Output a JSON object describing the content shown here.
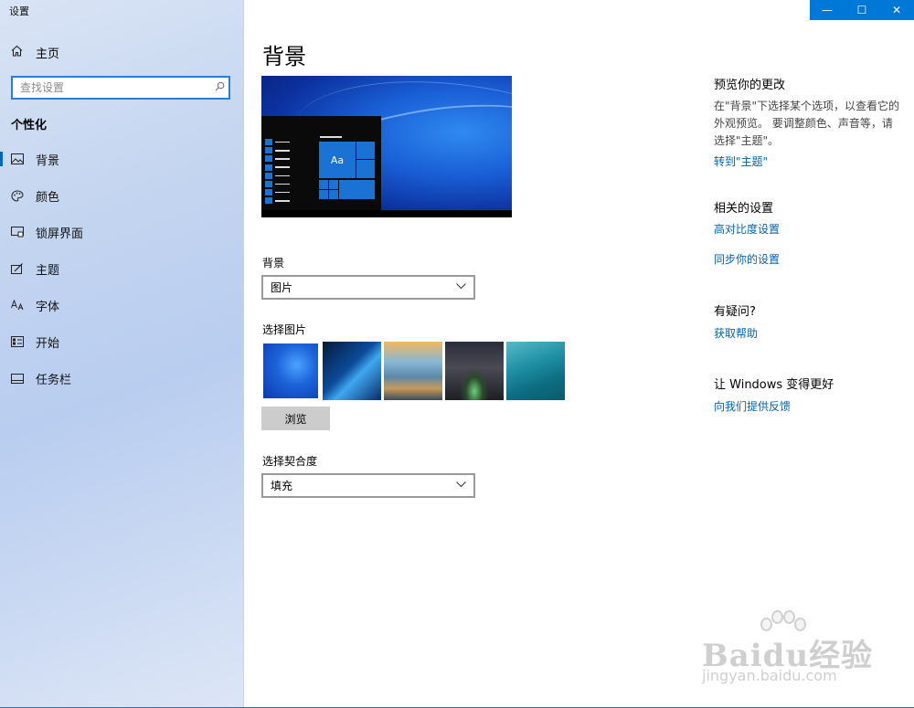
{
  "window": {
    "title": "设置",
    "controls": {
      "minimize": "—",
      "maximize": "☐",
      "close": "✕"
    }
  },
  "sidebar": {
    "home_label": "主页",
    "search_placeholder": "查找设置",
    "section_title": "个性化",
    "items": [
      {
        "label": "背景",
        "icon": "picture-icon",
        "active": true
      },
      {
        "label": "颜色",
        "icon": "palette-icon",
        "active": false
      },
      {
        "label": "锁屏界面",
        "icon": "lock-screen-icon",
        "active": false
      },
      {
        "label": "主题",
        "icon": "theme-icon",
        "active": false
      },
      {
        "label": "字体",
        "icon": "font-icon",
        "active": false
      },
      {
        "label": "开始",
        "icon": "start-icon",
        "active": false
      },
      {
        "label": "任务栏",
        "icon": "taskbar-icon",
        "active": false
      }
    ]
  },
  "main": {
    "title": "背景",
    "preview_tile_text": "Aa",
    "background_label": "背景",
    "background_value": "图片",
    "choose_picture_label": "选择图片",
    "browse_label": "浏览",
    "fit_label": "选择契合度",
    "fit_value": "填充"
  },
  "right": {
    "preview_heading": "预览你的更改",
    "preview_desc": "在\"背景\"下选择某个选项，以查看它的外观预览。 要调整颜色、声音等，请选择\"主题\"。",
    "preview_link": "转到\"主题\"",
    "related_heading": "相关的设置",
    "related_links": [
      "高对比度设置",
      "同步你的设置"
    ],
    "question_heading": "有疑问?",
    "help_link": "获取帮助",
    "feedback_heading": "让 Windows 变得更好",
    "feedback_link": "向我们提供反馈"
  },
  "watermark": {
    "brand": "Baidu经验",
    "url": "jingyan.baidu.com"
  },
  "colors": {
    "accent": "#0078d7",
    "link": "#0063b1",
    "sidebar_bg": "#c4d5f0"
  }
}
